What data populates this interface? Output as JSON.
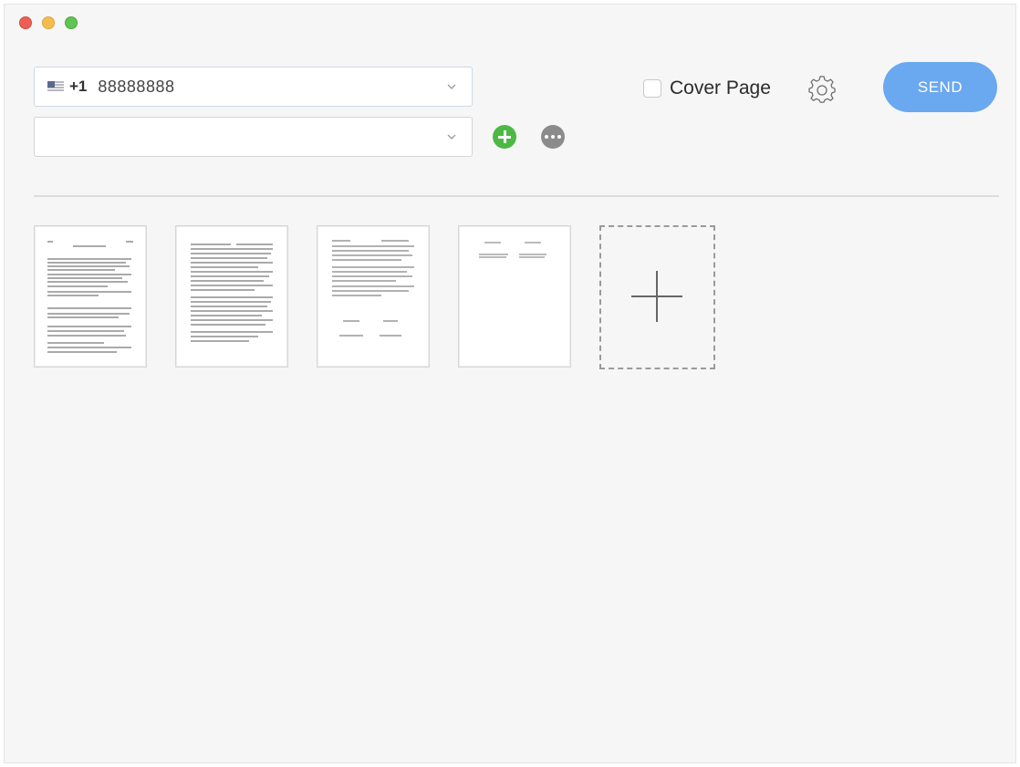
{
  "window": {
    "controls": [
      "close",
      "minimize",
      "maximize"
    ]
  },
  "recipient": {
    "country_code": "+1",
    "number": "88888888",
    "flag_icon": "us-flag-icon",
    "second_value": ""
  },
  "actions": {
    "add_icon": "plus-circle-icon",
    "more_icon": "ellipsis-circle-icon"
  },
  "cover_page": {
    "label": "Cover Page",
    "checked": false
  },
  "settings_icon": "gear-icon",
  "send_label": "SEND",
  "colors": {
    "send": "#6aa8f0",
    "add": "#4cb943",
    "more": "#8b8b8b"
  },
  "pages": [
    {
      "index": 1
    },
    {
      "index": 2
    },
    {
      "index": 3
    },
    {
      "index": 4
    }
  ],
  "add_page_icon": "plus-icon"
}
